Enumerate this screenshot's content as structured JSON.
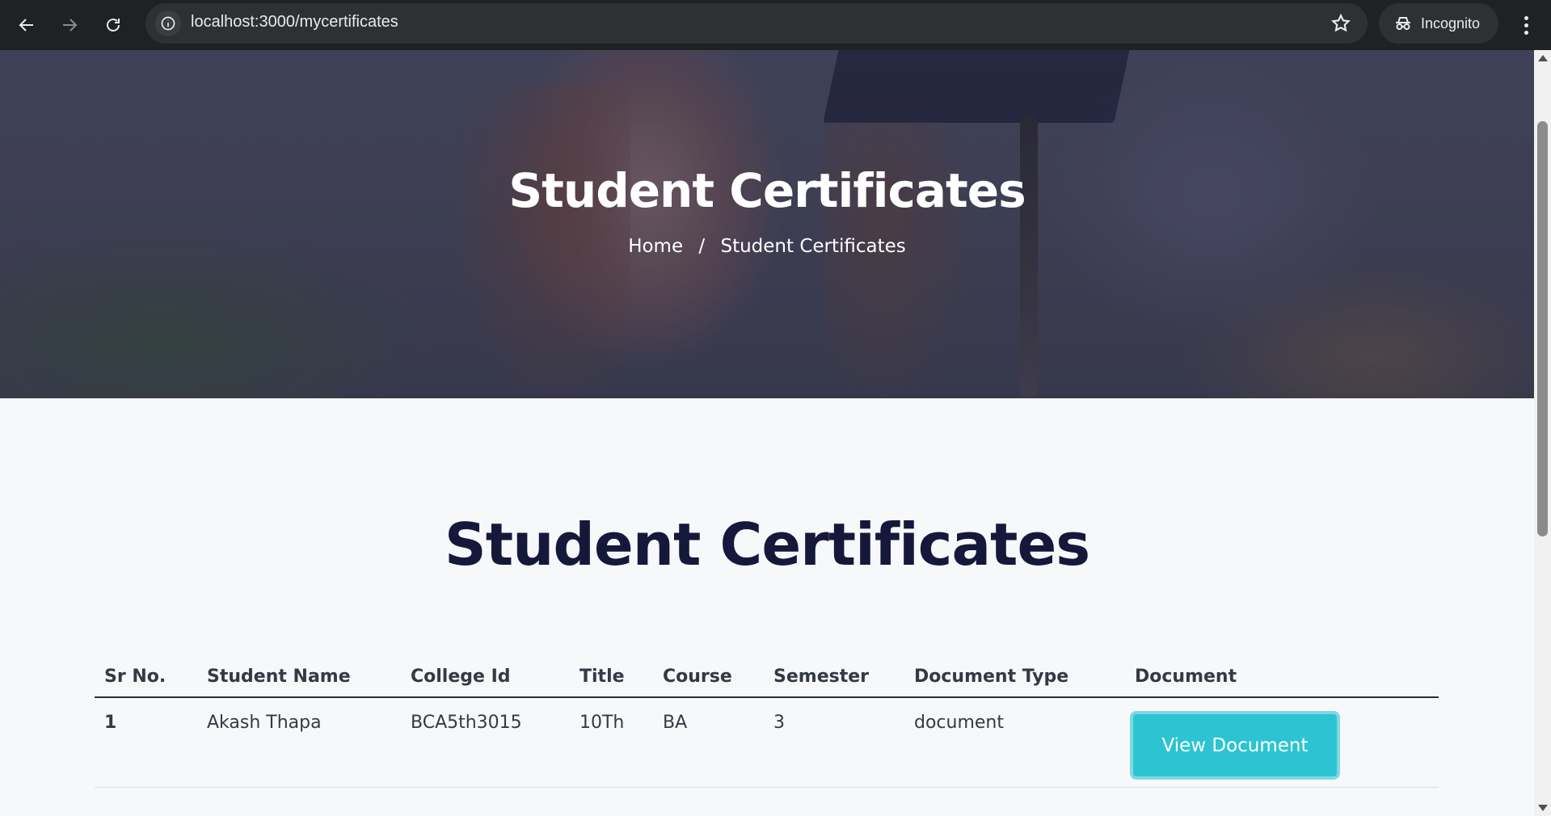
{
  "browser": {
    "url": "localhost:3000/mycertificates",
    "incognito_label": "Incognito"
  },
  "hero": {
    "title": "Student Certificates",
    "breadcrumb": {
      "home": "Home",
      "separator": "/",
      "current": "Student Certificates"
    }
  },
  "main": {
    "title": "Student Certificates",
    "table": {
      "columns": [
        "Sr No.",
        "Student Name",
        "College Id",
        "Title",
        "Course",
        "Semester",
        "Document Type",
        "Document"
      ],
      "rows": [
        {
          "sr": "1",
          "name": "Akash Thapa",
          "college_id": "BCA5th3015",
          "title": "10Th",
          "course": "BA",
          "semester": "3",
          "doc_type": "document",
          "action_label": "View Document"
        }
      ]
    }
  },
  "colors": {
    "accent": "#2cc4d3",
    "heading": "#15183a",
    "chrome_bg": "#202124"
  }
}
